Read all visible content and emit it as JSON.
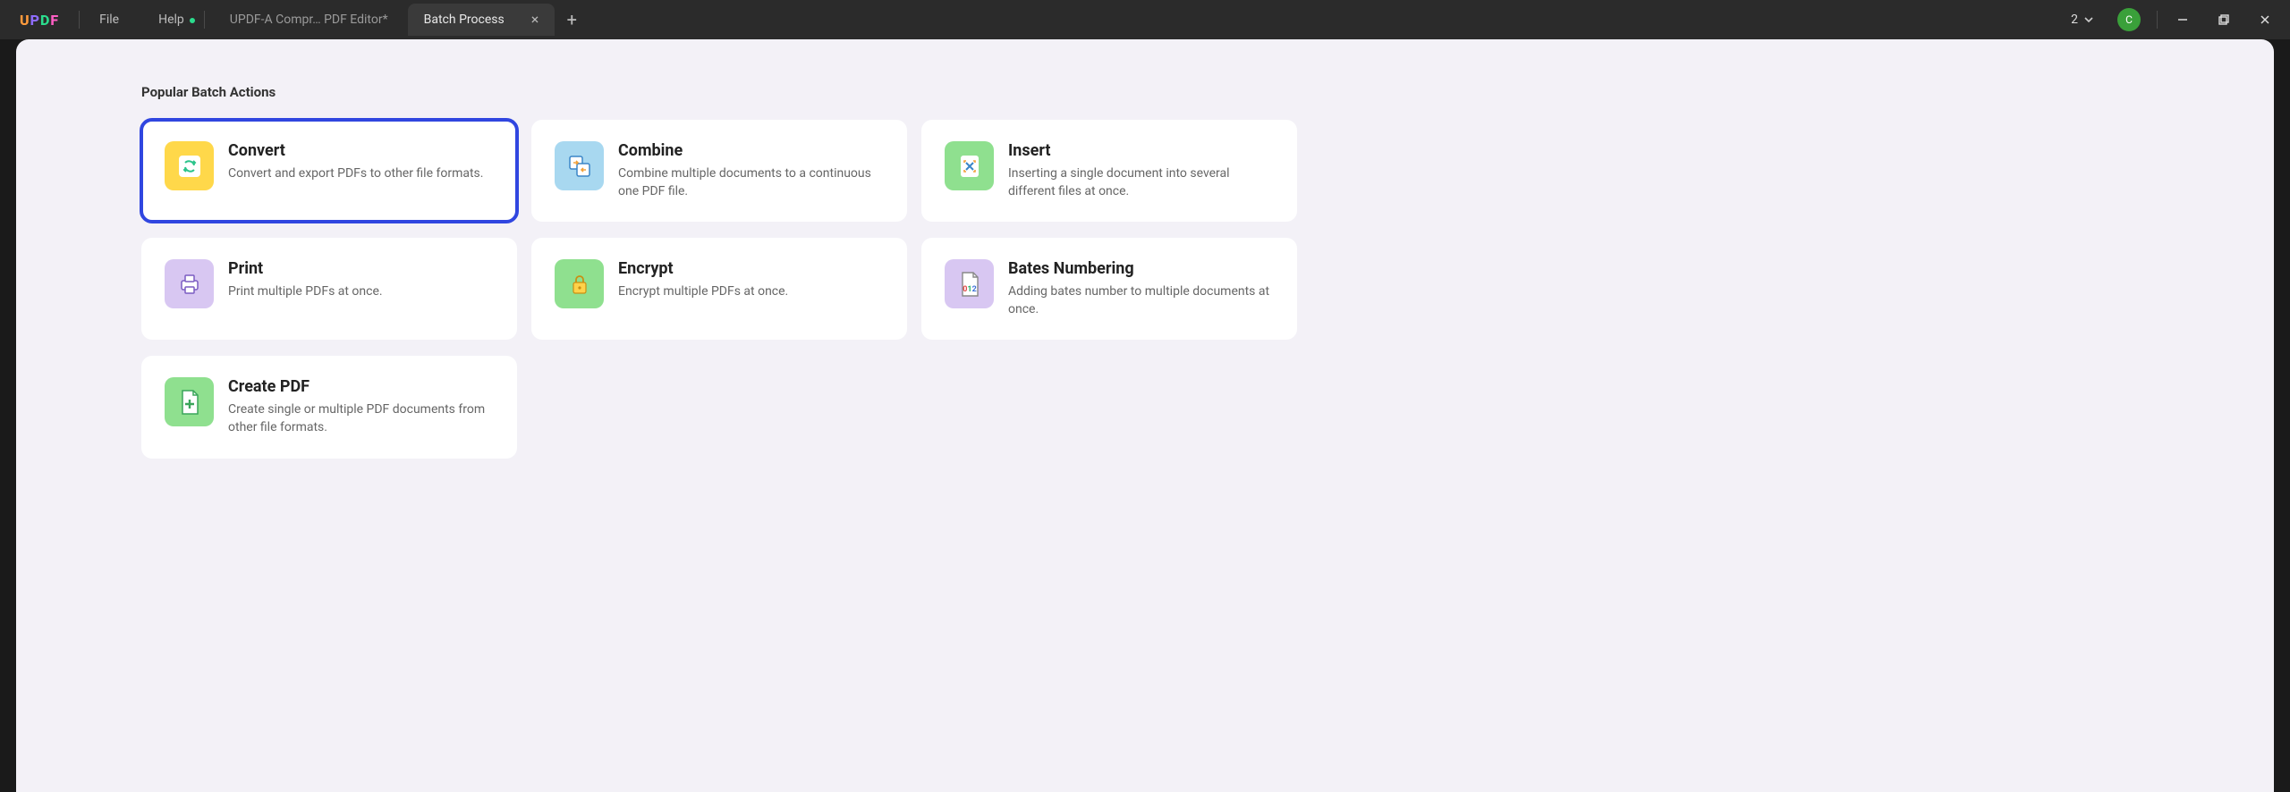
{
  "app": {
    "logo": "UPDF"
  },
  "menu": {
    "file": "File",
    "help": "Help"
  },
  "tabs": {
    "inactive": "UPDF-A Compr… PDF Editor*",
    "active": "Batch Process"
  },
  "window": {
    "count": "2",
    "avatar": "C"
  },
  "section": {
    "title": "Popular Batch Actions"
  },
  "cards": {
    "convert": {
      "title": "Convert",
      "desc": "Convert and export PDFs to other file formats."
    },
    "combine": {
      "title": "Combine",
      "desc": "Combine multiple documents to a continuous one PDF file."
    },
    "insert": {
      "title": "Insert",
      "desc": "Inserting a single document into several different files at once."
    },
    "print": {
      "title": "Print",
      "desc": "Print multiple PDFs at once."
    },
    "encrypt": {
      "title": "Encrypt",
      "desc": "Encrypt multiple PDFs at once."
    },
    "bates": {
      "title": "Bates Numbering",
      "desc": "Adding bates number to multiple documents at once."
    },
    "createpdf": {
      "title": "Create PDF",
      "desc": "Create single or multiple PDF documents from other file formats."
    }
  }
}
